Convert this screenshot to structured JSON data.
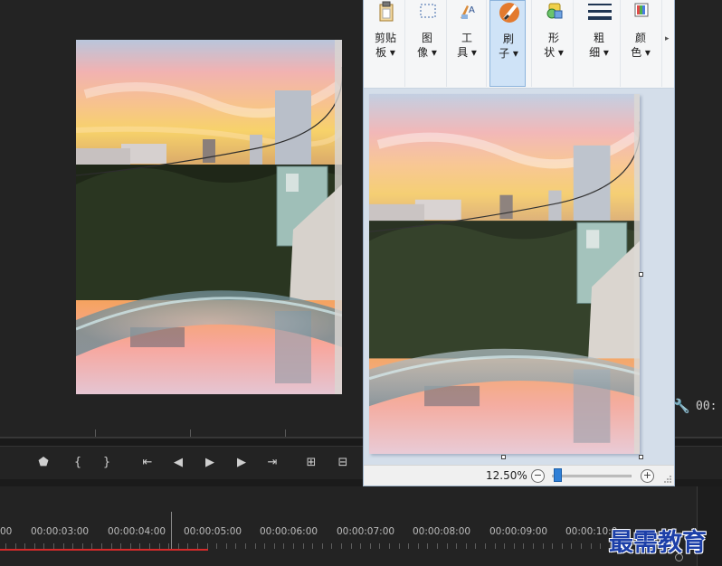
{
  "paint": {
    "ribbon": {
      "buttons": [
        {
          "id": "clipboard",
          "line1": "剪贴",
          "line2": "板",
          "icon": "clipboard-icon"
        },
        {
          "id": "image",
          "line1": "图",
          "line2": "像",
          "icon": "select-icon"
        },
        {
          "id": "tools",
          "line1": "工",
          "line2": "具",
          "icon": "tools-icon"
        },
        {
          "id": "brushes",
          "line1": "刷",
          "line2": "子",
          "icon": "brush-icon",
          "active": true
        },
        {
          "id": "shapes",
          "line1": "形",
          "line2": "状",
          "icon": "shapes-icon"
        },
        {
          "id": "size",
          "line1": "粗",
          "line2": "细",
          "icon": "line-size-icon"
        },
        {
          "id": "colors",
          "line1": "颜",
          "line2": "色",
          "icon": "colors-icon"
        }
      ],
      "more": "▸"
    },
    "status": {
      "zoom": "12.50%",
      "zoom_minus": "−",
      "zoom_plus": "+"
    }
  },
  "premiere": {
    "timecode_partial": "00:",
    "timeline": {
      "times": [
        "00",
        "00:00:03:00",
        "00:00:04:00",
        "00:00:05:00",
        "00:00:06:00",
        "00:00:07:00",
        "00:00:08:00",
        "00:00:09:00",
        "00:00:10:0"
      ]
    }
  },
  "watermark": "最需教育"
}
